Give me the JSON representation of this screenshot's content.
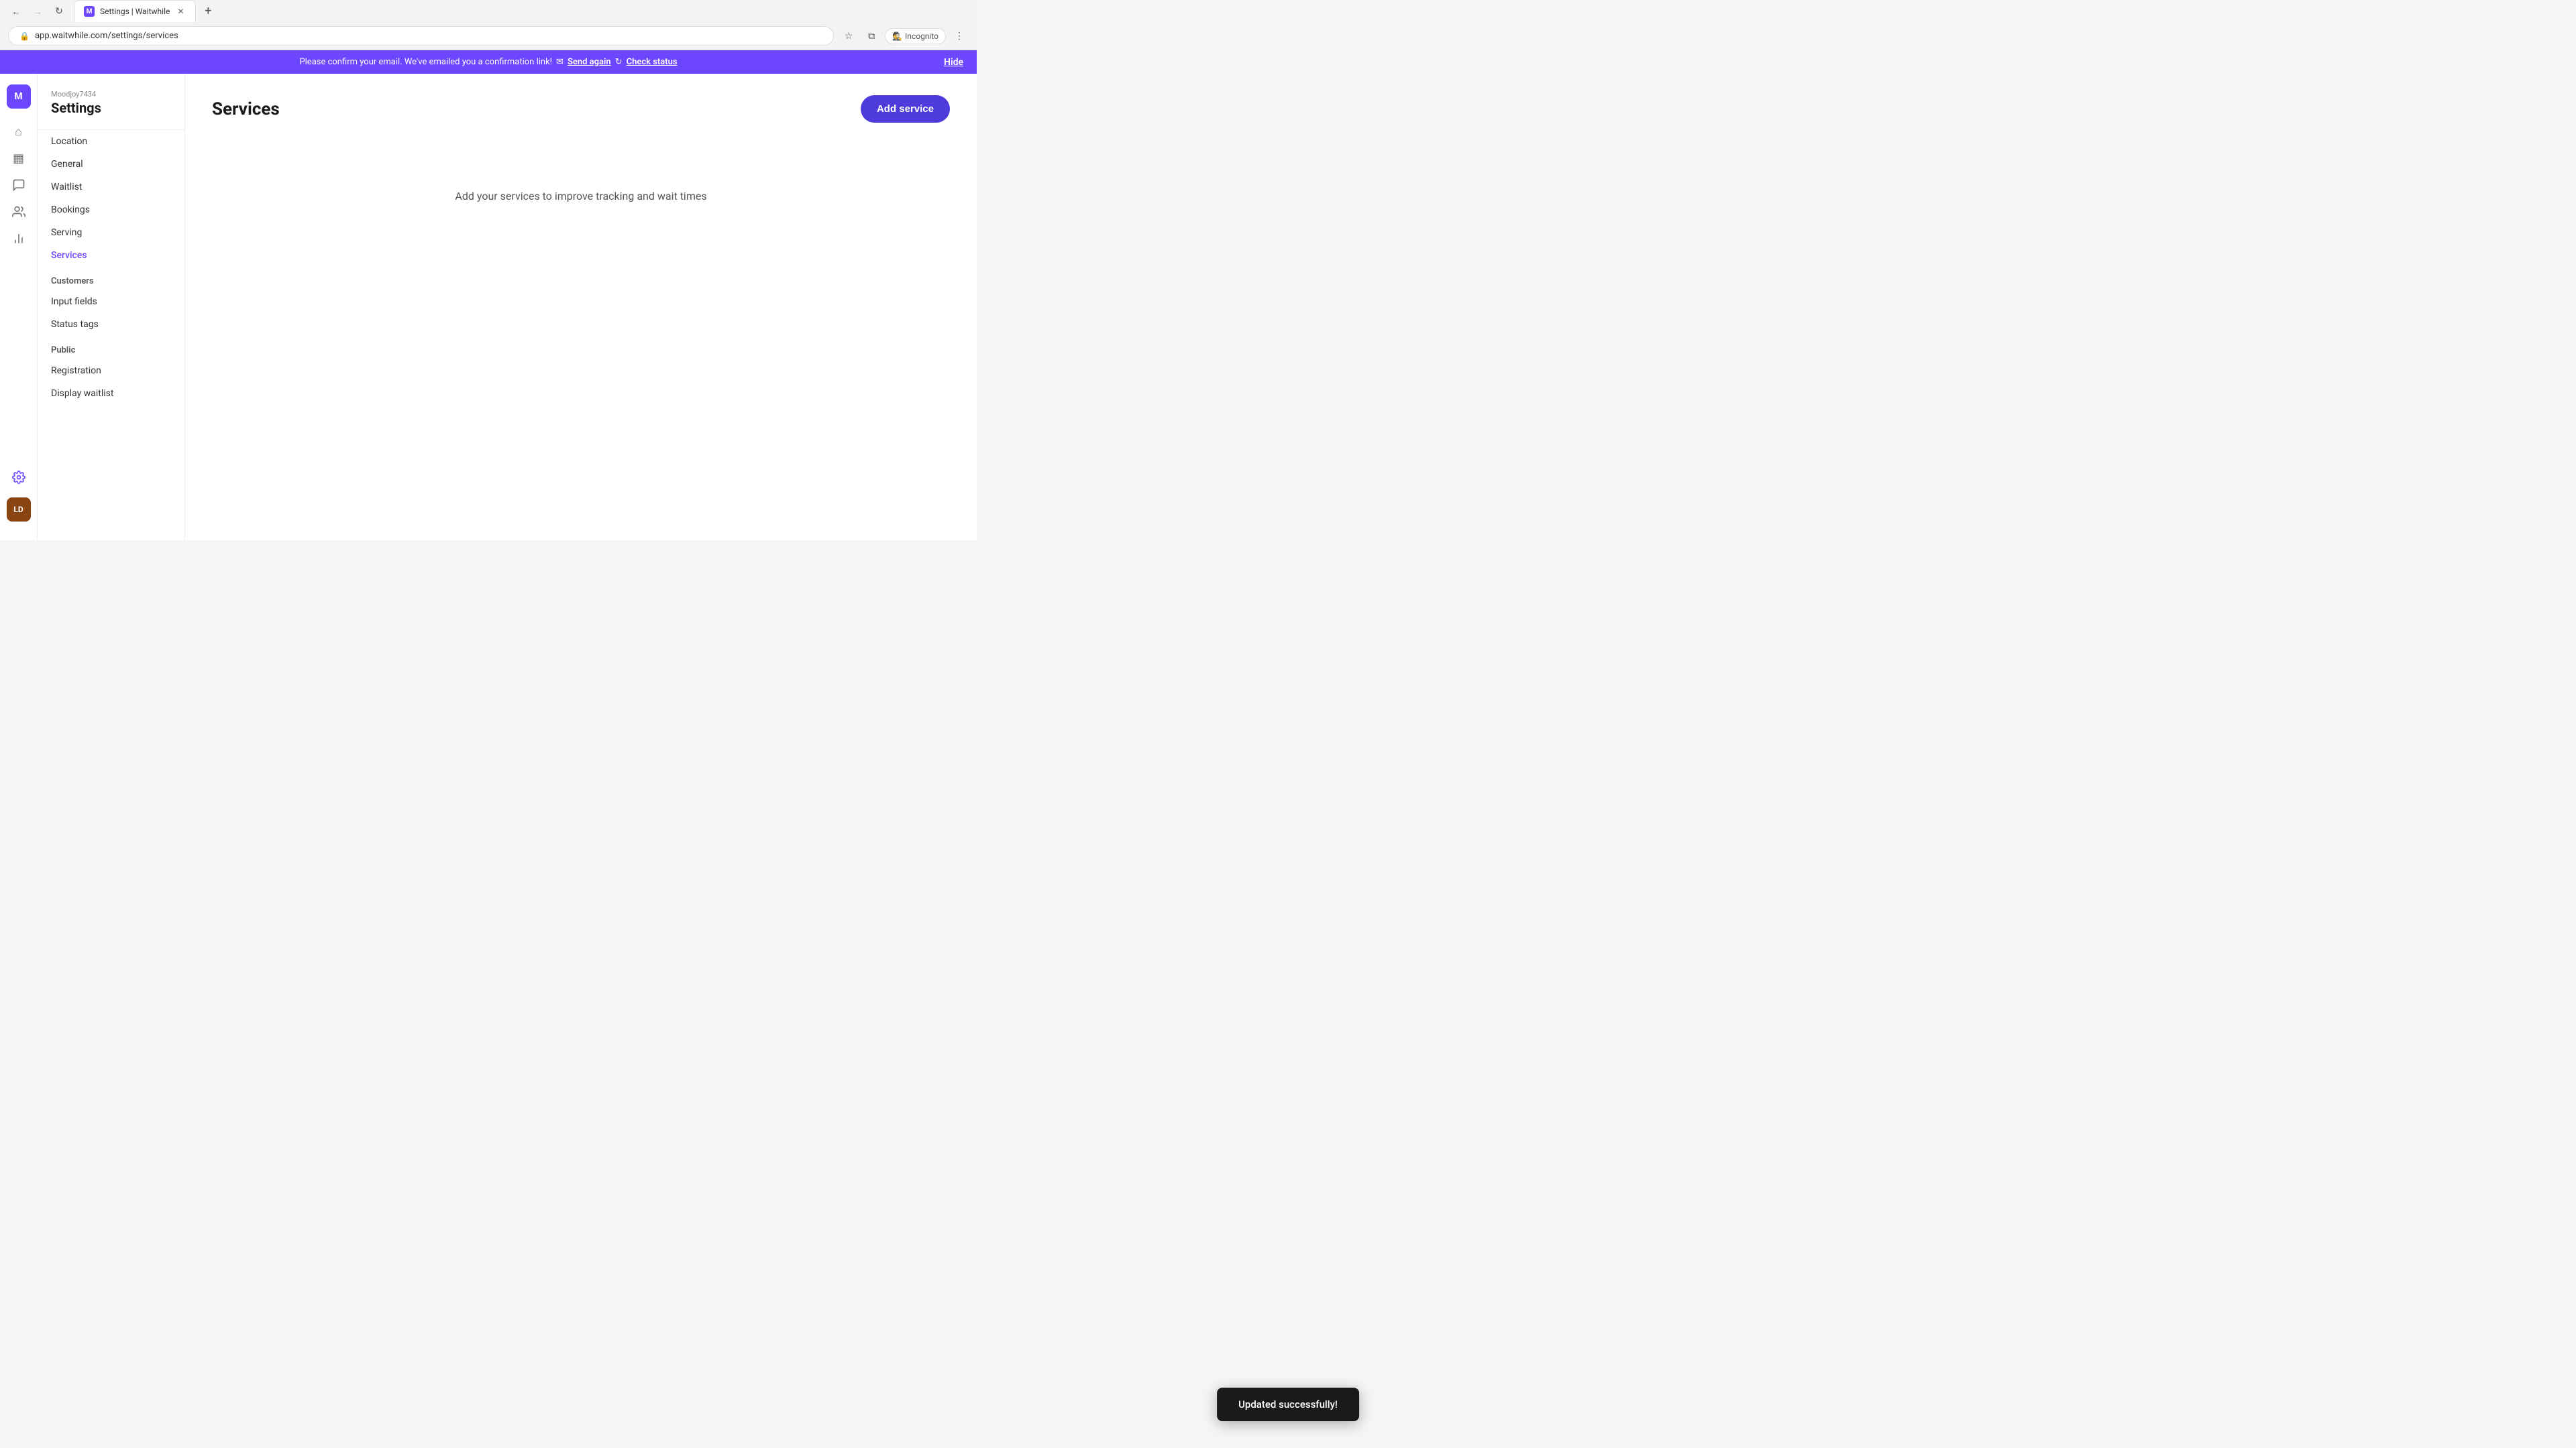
{
  "browser": {
    "tab_favicon": "M",
    "tab_title": "Settings | Waitwhile",
    "url": "app.waitwhile.com/settings/services",
    "new_tab_label": "+",
    "back_label": "←",
    "forward_label": "→",
    "reload_label": "↺",
    "incognito_label": "Incognito",
    "bookmark_label": "☆",
    "extensions_label": "🧩",
    "more_label": "⋮"
  },
  "banner": {
    "message": "Please confirm your email. We've emailed you a confirmation link!",
    "send_again_label": "Send again",
    "check_status_label": "Check status",
    "hide_label": "Hide"
  },
  "nav_icons": [
    {
      "name": "home",
      "symbol": "⌂",
      "active": false
    },
    {
      "name": "calendar",
      "symbol": "▦",
      "active": false
    },
    {
      "name": "chat",
      "symbol": "💬",
      "active": false
    },
    {
      "name": "team",
      "symbol": "👥",
      "active": false
    },
    {
      "name": "analytics",
      "symbol": "📊",
      "active": false
    }
  ],
  "sidebar": {
    "username": "Moodjoy7434",
    "title": "Settings",
    "items_location": [
      {
        "label": "Location"
      },
      {
        "label": "General"
      },
      {
        "label": "Waitlist"
      },
      {
        "label": "Bookings"
      },
      {
        "label": "Serving"
      },
      {
        "label": "Services",
        "active": true
      }
    ],
    "group_customers": "Customers",
    "items_customers": [
      {
        "label": "Input fields"
      },
      {
        "label": "Status tags"
      }
    ],
    "group_public": "Public",
    "items_public": [
      {
        "label": "Registration"
      },
      {
        "label": "Display waitlist"
      }
    ]
  },
  "main": {
    "page_title": "Services",
    "add_service_btn": "Add service",
    "empty_state_text": "Add your services to improve tracking and wait times"
  },
  "toast": {
    "message": "Updated successfully!"
  },
  "user_avatar": {
    "initials": "M"
  },
  "bottom_avatar": {
    "initials": "LD"
  }
}
